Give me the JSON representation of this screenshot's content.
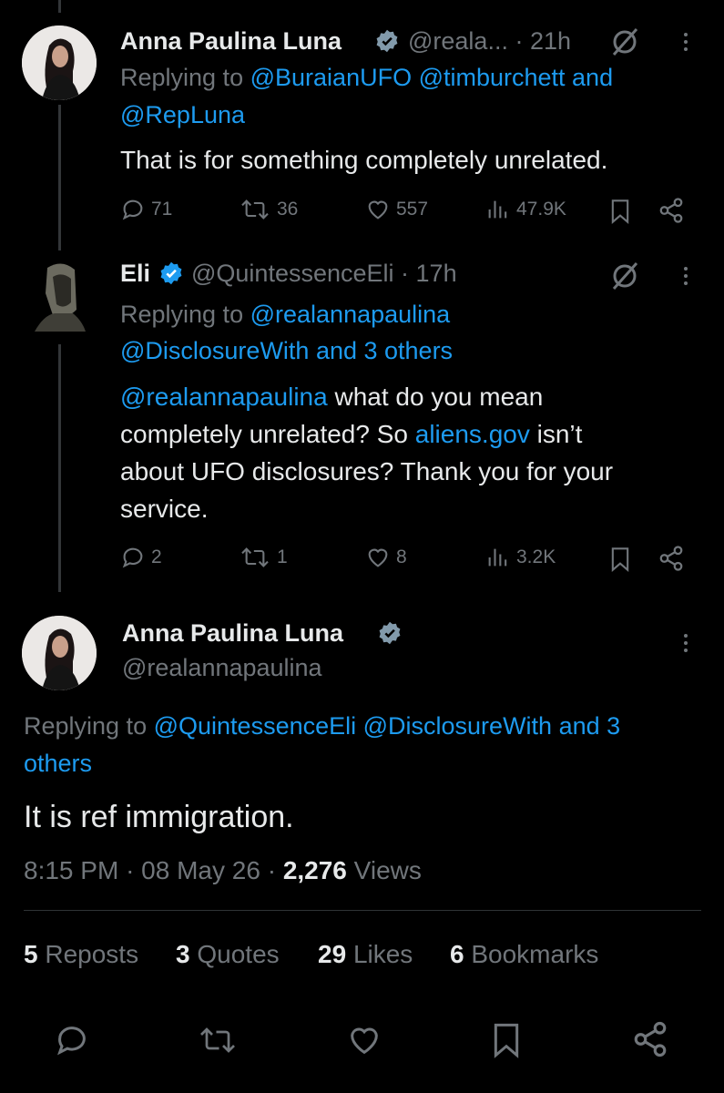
{
  "tweet1": {
    "name": "Anna Paulina Luna",
    "handle": "@reala...",
    "time": "21h",
    "replying_prefix": "Replying to",
    "replying_to": "@BuraianUFO @timburchett and",
    "replying_to2": "@RepLuna",
    "text": "That is for something completely unrelated.",
    "replies": "71",
    "reposts": "36",
    "likes": "557",
    "views": "47.9K"
  },
  "tweet2": {
    "name": "Eli",
    "handle": "@QuintessenceEli",
    "time": "17h",
    "replying_prefix": "Replying to",
    "replying_to": "@realannapaulina",
    "replying_to2": "@DisclosureWith and 3 others",
    "text_mention": "@realannapaulina",
    "text_part1": " what do you mean",
    "text_line2a": "completely unrelated? So ",
    "text_link": "aliens.gov",
    "text_line2b": " isn’t",
    "text_line3": "about UFO disclosures? Thank you for your",
    "text_line4": "service.",
    "replies": "2",
    "reposts": "1",
    "likes": "8",
    "views": "3.2K"
  },
  "main": {
    "name": "Anna Paulina Luna",
    "handle": "@realannapaulina",
    "replying_prefix": "Replying to",
    "replying_to": "@QuintessenceEli @DisclosureWith and 3",
    "replying_to2": "others",
    "text": "It is ref immigration.",
    "time": "8:15 PM",
    "date": "08 May 26",
    "views_count": "2,276",
    "views_label": "Views",
    "reposts_count": "5",
    "reposts_label": "Reposts",
    "quotes_count": "3",
    "quotes_label": "Quotes",
    "likes_count": "29",
    "likes_label": "Likes",
    "bookmarks_count": "6",
    "bookmarks_label": "Bookmarks"
  },
  "colors": {
    "accent": "#1d9bf0",
    "muted": "#71767b",
    "text": "#e7e9ea",
    "background": "#000000"
  }
}
